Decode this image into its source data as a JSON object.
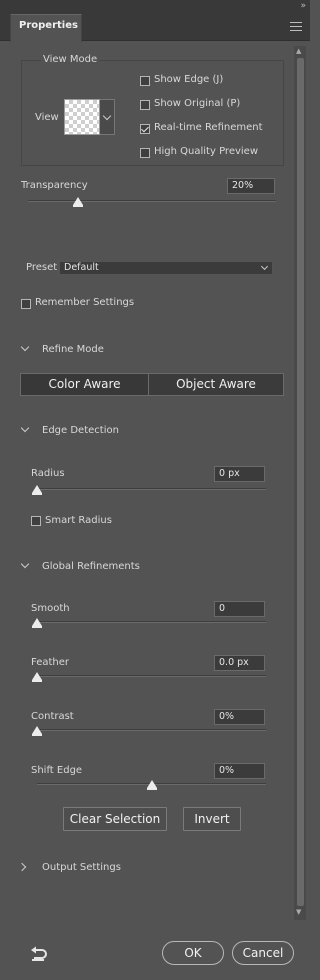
{
  "panel": {
    "tab_label": "Properties",
    "collapse_glyph": "»"
  },
  "view_mode": {
    "title": "View Mode",
    "view_label": "View",
    "options": [
      {
        "label": "Show Edge (J)",
        "checked": false
      },
      {
        "label": "Show Original (P)",
        "checked": false
      },
      {
        "label": "Real-time Refinement",
        "checked": true
      },
      {
        "label": "High Quality Preview",
        "checked": false
      }
    ]
  },
  "transparency": {
    "label": "Transparency",
    "value": "20%",
    "level": 0.2
  },
  "preset": {
    "label": "Preset",
    "value": "Default"
  },
  "remember_settings": {
    "label": "Remember Settings",
    "checked": false
  },
  "refine_mode": {
    "title": "Refine Mode",
    "options": [
      "Color Aware",
      "Object Aware"
    ],
    "selected": "Color Aware"
  },
  "edge_detection": {
    "title": "Edge Detection",
    "radius": {
      "label": "Radius",
      "value": "0 px",
      "level": 0
    },
    "smart_radius": {
      "label": "Smart Radius",
      "checked": false
    }
  },
  "global_refinements": {
    "title": "Global Refinements",
    "smooth": {
      "label": "Smooth",
      "value": "0",
      "level": 0
    },
    "feather": {
      "label": "Feather",
      "value": "0.0 px",
      "level": 0
    },
    "contrast": {
      "label": "Contrast",
      "value": "0%",
      "level": 0
    },
    "shift_edge": {
      "label": "Shift Edge",
      "value": "0%",
      "level": 0.5
    }
  },
  "actions": {
    "clear_selection": "Clear Selection",
    "invert": "Invert"
  },
  "output_settings": {
    "title": "Output Settings"
  },
  "footer": {
    "ok": "OK",
    "cancel": "Cancel"
  }
}
